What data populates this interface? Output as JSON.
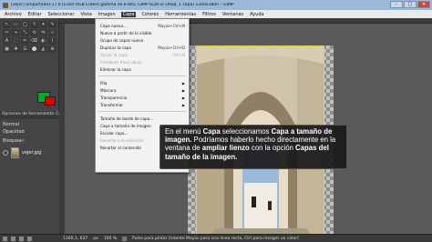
{
  "window": {
    "title": "[vejer] (importada)-17.0 (Color RGB Entero gamma de 8 bits, GIMP built-in sRGB, 1 capa) 1200x1800 – GIMP",
    "controls": [
      "–",
      "□",
      "✕"
    ]
  },
  "menubar": {
    "items": [
      "Archivo",
      "Editar",
      "Seleccionar",
      "Vista",
      "Imagen",
      "Capa",
      "Colores",
      "Herramientas",
      "Filtros",
      "Ventanas",
      "Ayuda"
    ],
    "active": "Capa"
  },
  "toolbox": {
    "tools": [
      "↖",
      "▭",
      "◯",
      "ϟ",
      "✦",
      "✎",
      "✂",
      "⌖",
      "⤡",
      "⟲",
      "⇋",
      "▱",
      "A",
      "⬚",
      "✏",
      "⌫",
      "◐",
      "⌇",
      "▣",
      "✚",
      "☰",
      "⬤",
      "◭",
      "⊕"
    ],
    "tool_options_label": "Opciones de herramienta",
    "colors": {
      "foreground": "#0aa82c",
      "background": "#e00000"
    }
  },
  "layers_dock": {
    "tabs": [
      "Opciones de herramienta",
      "Capas"
    ],
    "mode_label": "Normal",
    "opacity_label": "Opacidad",
    "lock_label": "Bloquear:",
    "layer": {
      "name": "vejer.jpg"
    }
  },
  "layer_menu": {
    "items": [
      {
        "label": "Capa nueva...",
        "shortcut": "Mayús+Ctrl+N",
        "disabled": false
      },
      {
        "label": "Nuevo a partir de lo visible",
        "shortcut": "",
        "disabled": false
      },
      {
        "label": "Grupo de capas nuevo",
        "shortcut": "",
        "disabled": false
      },
      {
        "label": "Duplicar la capa",
        "shortcut": "Mayús+Ctrl+D",
        "disabled": false
      },
      {
        "label": "Anclar la capa",
        "shortcut": "Ctrl+H",
        "disabled": true
      },
      {
        "label": "Combinar hacia abajo",
        "shortcut": "",
        "disabled": true
      },
      {
        "label": "Eliminar la capa",
        "shortcut": "",
        "disabled": false
      },
      {
        "label": "Pila",
        "submenu": true
      },
      {
        "label": "Máscara",
        "submenu": true
      },
      {
        "label": "Transparencia",
        "submenu": true
      },
      {
        "label": "Transformar",
        "submenu": true
      },
      {
        "label": "Tamaño de borde de capa...",
        "shortcut": ""
      },
      {
        "label": "Capa a tamaño de imagen",
        "shortcut": ""
      },
      {
        "label": "Escalar capa...",
        "shortcut": ""
      },
      {
        "label": "Recortar a la selección",
        "shortcut": "",
        "disabled": true
      },
      {
        "label": "Recortar al contenido",
        "shortcut": ""
      }
    ]
  },
  "tooltip": {
    "t1": "En el menú ",
    "b1": "Capa",
    "t2": " seleccionamos ",
    "b2": "Capa a tamaño de imagen.",
    "t3": " Podríamos haberlo hecho directamente en la ventana de ",
    "b3": "ampliar lienzo",
    "t4": " con la opción ",
    "b4": "Capas del tamaño de la imagen."
  },
  "status": {
    "coords": "1160,1, 637",
    "unit": "px",
    "zoom": "100 %",
    "hint": "Pulse para pintar (intente Mayús para una línea recta, Ctrl para recoger un color)"
  }
}
